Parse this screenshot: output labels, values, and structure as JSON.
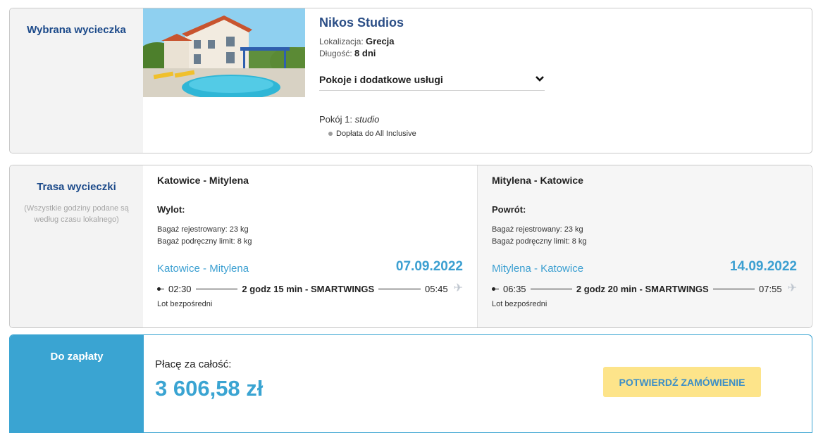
{
  "trip": {
    "section_title": "Wybrana wycieczka",
    "hotel_name": "Nikos Studios",
    "location_label": "Lokalizacja:",
    "location_value": "Grecja",
    "duration_label": "Długość:",
    "duration_value": "8 dni",
    "rooms_toggle_label": "Pokoje i dodatkowe usługi",
    "room_label": "Pokój 1:",
    "room_type": "studio",
    "room_extra": "Dopłata do All Inclusive"
  },
  "route": {
    "section_title": "Trasa wycieczki",
    "section_note": "(Wszystkie godziny podane są według czasu lokalnego)",
    "legs": [
      {
        "title": "Katowice - Mitylena",
        "direction": "Wylot:",
        "bag_checked": "Bagaż rejestrowany: 23 kg",
        "bag_hand": "Bagaż podręczny limit: 8 kg",
        "route_name": "Katowice - Mitylena",
        "date": "07.09.2022",
        "depart_time": "02:30",
        "duration": "2 godz 15 min",
        "carrier": "SMARTWINGS",
        "arrive_time": "05:45",
        "direct": "Lot bezpośredni"
      },
      {
        "title": "Mitylena - Katowice",
        "direction": "Powrót:",
        "bag_checked": "Bagaż rejestrowany: 23 kg",
        "bag_hand": "Bagaż podręczny limit: 8 kg",
        "route_name": "Mitylena - Katowice",
        "date": "14.09.2022",
        "depart_time": "06:35",
        "duration": "2 godz 20 min",
        "carrier": "SMARTWINGS",
        "arrive_time": "07:55",
        "direct": "Lot bezpośredni"
      }
    ],
    "separator": "-"
  },
  "payment": {
    "section_title": "Do zapłaty",
    "pay_label": "Płacę za całość:",
    "amount": "3 606,58 zł",
    "confirm_button": "POTWIERDŹ ZAMÓWIENIE"
  },
  "colors": {
    "accent_blue": "#3aa4d2",
    "title_navy": "#1c4a8a",
    "button_yellow": "#fde48a"
  },
  "icons": {
    "rooms_toggle": "chevron-down-icon",
    "flight_arrival": "airplane-icon",
    "extra_bullet": "bullet-dot-icon"
  }
}
